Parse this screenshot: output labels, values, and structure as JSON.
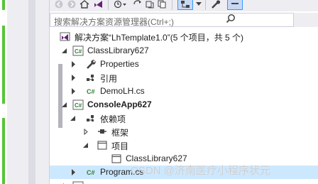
{
  "search": {
    "placeholder": "搜索解决方案资源管理器(Ctrl+;)"
  },
  "tree": {
    "solution": "解决方案“LhTemplate1.0”(5 个项目，共 5 个)",
    "class_library": "ClassLibrary627",
    "properties": "Properties",
    "references": "引用",
    "demo_file": "DemoLH.cs",
    "console_app": "ConsoleApp627",
    "dependencies": "依赖项",
    "frameworks": "框架",
    "projects": "项目",
    "project_ref": "ClassLibrary627",
    "program_file": "Program.cs"
  },
  "watermark": "CSDN @济南医疗小程序状元",
  "colors": {
    "accent": "#3399ff",
    "selection": "#cce8ff",
    "change_marker": "#57c63a"
  },
  "icons": [
    "home-icon",
    "vs-icon",
    "history-icon",
    "refresh-icon",
    "copy-icon",
    "sync-icon",
    "wrench-icon",
    "search-icon"
  ]
}
